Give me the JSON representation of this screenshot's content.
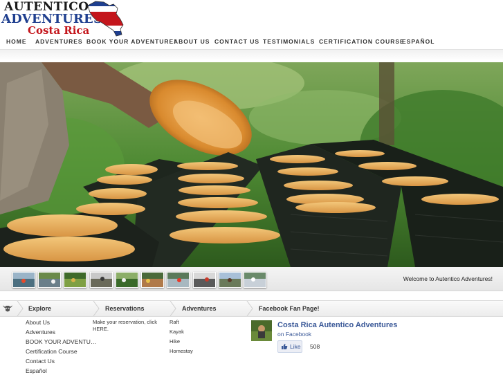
{
  "logo": {
    "line1": "AUTENTICO",
    "line2": "ADVENTURES",
    "line3": "Costa Rica",
    "map_icon": "costa-rica-flag-map-icon"
  },
  "nav": {
    "items": [
      "HOME",
      "ADVENTURES",
      "BOOK YOUR ADVENTURE!",
      "ABOUT US",
      "CONTACT US",
      "TESTIMONIALS",
      "CERTIFICATION COURSE",
      "ESPAÑOL"
    ]
  },
  "hero": {
    "icon": "slideshow-image-food-preparation"
  },
  "slideshow": {
    "thumbnails": [
      {
        "name": "thumb-raft"
      },
      {
        "name": "thumb-river"
      },
      {
        "name": "thumb-field"
      },
      {
        "name": "thumb-farm"
      },
      {
        "name": "thumb-forest"
      },
      {
        "name": "thumb-group"
      },
      {
        "name": "thumb-rafting"
      },
      {
        "name": "thumb-car"
      },
      {
        "name": "thumb-horse"
      },
      {
        "name": "thumb-waterfall"
      }
    ],
    "caption": "Welcome to Autentico Adventures!"
  },
  "footer": {
    "logo_icon": "bull-head-icon",
    "headings": [
      "Explore",
      "Reservations",
      "Adventures",
      "Facebook Fan Page!"
    ],
    "explore": [
      "About Us",
      "Adventures",
      "BOOK YOUR ADVENTU…",
      "Certification Course",
      "Contact Us",
      "Español"
    ],
    "reservations_text": "Make your reservation, click HERE.",
    "adventures": [
      "Raft",
      "Kayak",
      "Hike",
      "Homestay"
    ],
    "facebook": {
      "page_name": "Costa Rica Autentico Adventures",
      "on_facebook": "on Facebook",
      "like_label": "Like",
      "like_count": "508"
    }
  },
  "colors": {
    "logo_blue": "#1f3f8f",
    "logo_red": "#c4161c",
    "facebook_blue": "#3b5998"
  }
}
